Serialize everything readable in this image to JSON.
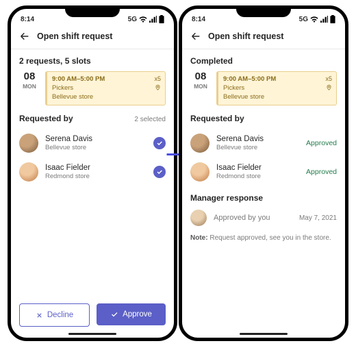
{
  "statusbar": {
    "time": "8:14",
    "network": "5G"
  },
  "header": {
    "title": "Open shift request"
  },
  "shift": {
    "day": "08",
    "dow": "MON",
    "time": "9:00 AM–5:00 PM",
    "role": "Pickers",
    "location": "Bellevue store",
    "multiplier": "x5"
  },
  "left": {
    "summary": "2 requests, 5 slots",
    "requested_by_heading": "Requested by",
    "selected_text": "2 selected",
    "people": [
      {
        "name": "Serena Davis",
        "store": "Bellevue store"
      },
      {
        "name": "Isaac Fielder",
        "store": "Redmond store"
      }
    ],
    "buttons": {
      "decline": "Decline",
      "approve": "Approve"
    }
  },
  "right": {
    "summary": "Completed",
    "requested_by_heading": "Requested by",
    "people": [
      {
        "name": "Serena Davis",
        "store": "Bellevue store",
        "status": "Approved"
      },
      {
        "name": "Isaac Fielder",
        "store": "Redmond store",
        "status": "Approved"
      }
    ],
    "manager": {
      "heading": "Manager response",
      "status": "Approved by you",
      "date": "May 7, 2021",
      "note_label": "Note:",
      "note_text": "Request approved, see you in the store."
    }
  }
}
